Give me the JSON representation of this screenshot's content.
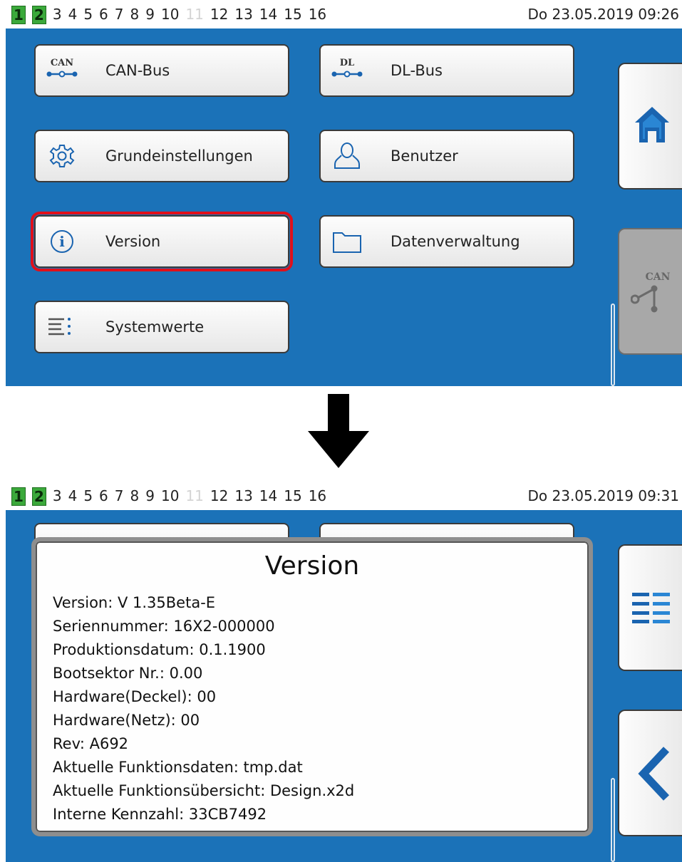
{
  "screen1": {
    "status": {
      "nodes": [
        {
          "label": "1",
          "state": "active"
        },
        {
          "label": "2",
          "state": "active"
        },
        {
          "label": "3",
          "state": "normal"
        },
        {
          "label": "4",
          "state": "normal"
        },
        {
          "label": "5",
          "state": "normal"
        },
        {
          "label": "6",
          "state": "normal"
        },
        {
          "label": "7",
          "state": "normal"
        },
        {
          "label": "8",
          "state": "normal"
        },
        {
          "label": "9",
          "state": "normal"
        },
        {
          "label": "10",
          "state": "normal"
        },
        {
          "label": "11",
          "state": "dim"
        },
        {
          "label": "12",
          "state": "normal"
        },
        {
          "label": "13",
          "state": "normal"
        },
        {
          "label": "14",
          "state": "normal"
        },
        {
          "label": "15",
          "state": "normal"
        },
        {
          "label": "16",
          "state": "normal"
        }
      ],
      "datetime": "Do 23.05.2019 09:26"
    },
    "menu": {
      "can_bus": {
        "label": "CAN-Bus",
        "icon_text": "CAN",
        "icon": "can-bus-icon"
      },
      "dl_bus": {
        "label": "DL-Bus",
        "icon_text": "DL",
        "icon": "dl-bus-icon"
      },
      "grundeinstellungen": {
        "label": "Grundeinstellungen",
        "icon": "gear-icon"
      },
      "benutzer": {
        "label": "Benutzer",
        "icon": "user-icon"
      },
      "version": {
        "label": "Version",
        "icon": "info-icon",
        "selected": true
      },
      "datenverwaltung": {
        "label": "Datenverwaltung",
        "icon": "folder-icon"
      },
      "systemwerte": {
        "label": "Systemwerte",
        "icon": "list-icon"
      }
    },
    "side": {
      "home": {
        "icon": "home-icon"
      },
      "can": {
        "icon_text": "CAN",
        "icon": "can-network-icon",
        "state": "disabled"
      }
    }
  },
  "screen2": {
    "status": {
      "nodes": [
        {
          "label": "1",
          "state": "active"
        },
        {
          "label": "2",
          "state": "active"
        },
        {
          "label": "3",
          "state": "normal"
        },
        {
          "label": "4",
          "state": "normal"
        },
        {
          "label": "5",
          "state": "normal"
        },
        {
          "label": "6",
          "state": "normal"
        },
        {
          "label": "7",
          "state": "normal"
        },
        {
          "label": "8",
          "state": "normal"
        },
        {
          "label": "9",
          "state": "normal"
        },
        {
          "label": "10",
          "state": "normal"
        },
        {
          "label": "11",
          "state": "dim"
        },
        {
          "label": "12",
          "state": "normal"
        },
        {
          "label": "13",
          "state": "normal"
        },
        {
          "label": "14",
          "state": "normal"
        },
        {
          "label": "15",
          "state": "normal"
        },
        {
          "label": "16",
          "state": "normal"
        }
      ],
      "datetime": "Do 23.05.2019 09:31"
    },
    "dialog": {
      "title": "Version",
      "lines": [
        "Version: V 1.35Beta-E",
        "Seriennummer: 16X2-000000",
        "Produktionsdatum: 0.1.1900",
        "Bootsektor Nr.: 0.00",
        "Hardware(Deckel): 00",
        "Hardware(Netz): 00",
        "Rev: A692",
        "Aktuelle Funktionsdaten: tmp.dat",
        "Aktuelle Funktionsübersicht: Design.x2d",
        "Interne Kennzahl: 33CB7492"
      ]
    },
    "side": {
      "menu": {
        "icon": "menu-list-icon"
      },
      "back": {
        "icon": "back-chevron-icon"
      }
    }
  },
  "colors": {
    "background_blue": "#1b72b8",
    "node_active_green": "#3ba93b",
    "selection_red": "#e0101a",
    "icon_blue": "#1a64b0"
  }
}
